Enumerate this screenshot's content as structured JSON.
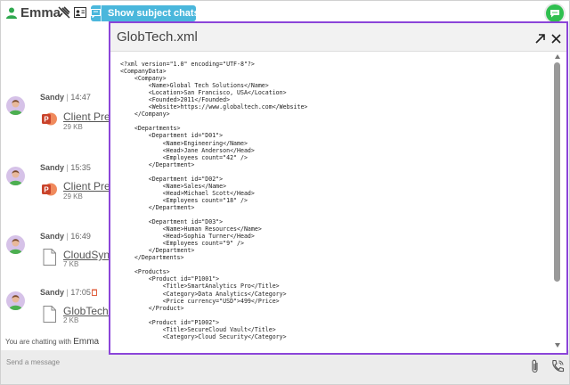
{
  "header": {
    "contact_name": "Emma",
    "subject_chats_label": "Show subject chats",
    "colors": {
      "accent": "#4ab7dc",
      "online": "#2fbf4f",
      "modal_border": "#8b45d9"
    }
  },
  "messages": [
    {
      "sender": "Sandy",
      "time": "14:47",
      "file_name": "Client Pres",
      "file_size": "29 KB",
      "file_type": "powerpoint-icon",
      "deletable": false
    },
    {
      "sender": "Sandy",
      "time": "15:35",
      "file_name": "Client Pres",
      "file_size": "29 KB",
      "file_type": "powerpoint-icon",
      "deletable": false
    },
    {
      "sender": "Sandy",
      "time": "16:49",
      "file_name": "CloudSync",
      "file_size": "7 KB",
      "file_type": "document-icon",
      "deletable": false
    },
    {
      "sender": "Sandy",
      "time": "17:05",
      "file_name": "GlobTech.x",
      "file_size": "2 KB",
      "file_type": "document-icon",
      "deletable": true
    }
  ],
  "status": {
    "prefix": "You are chatting with",
    "contact": "Emma"
  },
  "composer": {
    "placeholder": "Send a message"
  },
  "viewer": {
    "title": "GlobTech.xml",
    "lines": [
      "<?xml version=\"1.0\" encoding=\"UTF-8\"?>",
      "<CompanyData>",
      "    <Company>",
      "        <Name>Global Tech Solutions</Name>",
      "        <Location>San Francisco, USA</Location>",
      "        <Founded>2011</Founded>",
      "        <Website>https://www.globaltech.com</Website>",
      "    </Company>",
      "",
      "    <Departments>",
      "        <Department id=\"D01\">",
      "            <Name>Engineering</Name>",
      "            <Head>Jane Anderson</Head>",
      "            <Employees count=\"42\" />",
      "        </Department>",
      "",
      "        <Department id=\"D02\">",
      "            <Name>Sales</Name>",
      "            <Head>Michael Scott</Head>",
      "            <Employees count=\"18\" />",
      "        </Department>",
      "",
      "        <Department id=\"D03\">",
      "            <Name>Human Resources</Name>",
      "            <Head>Sophia Turner</Head>",
      "            <Employees count=\"9\" />",
      "        </Department>",
      "    </Departments>",
      "",
      "    <Products>",
      "        <Product id=\"P1001\">",
      "            <Title>SmartAnalytics Pro</Title>",
      "            <Category>Data Analytics</Category>",
      "            <Price currency=\"USD\">499</Price>",
      "        </Product>",
      "",
      "        <Product id=\"P1002\">",
      "            <Title>SecureCloud Vault</Title>",
      "            <Category>Cloud Security</Category>"
    ]
  }
}
